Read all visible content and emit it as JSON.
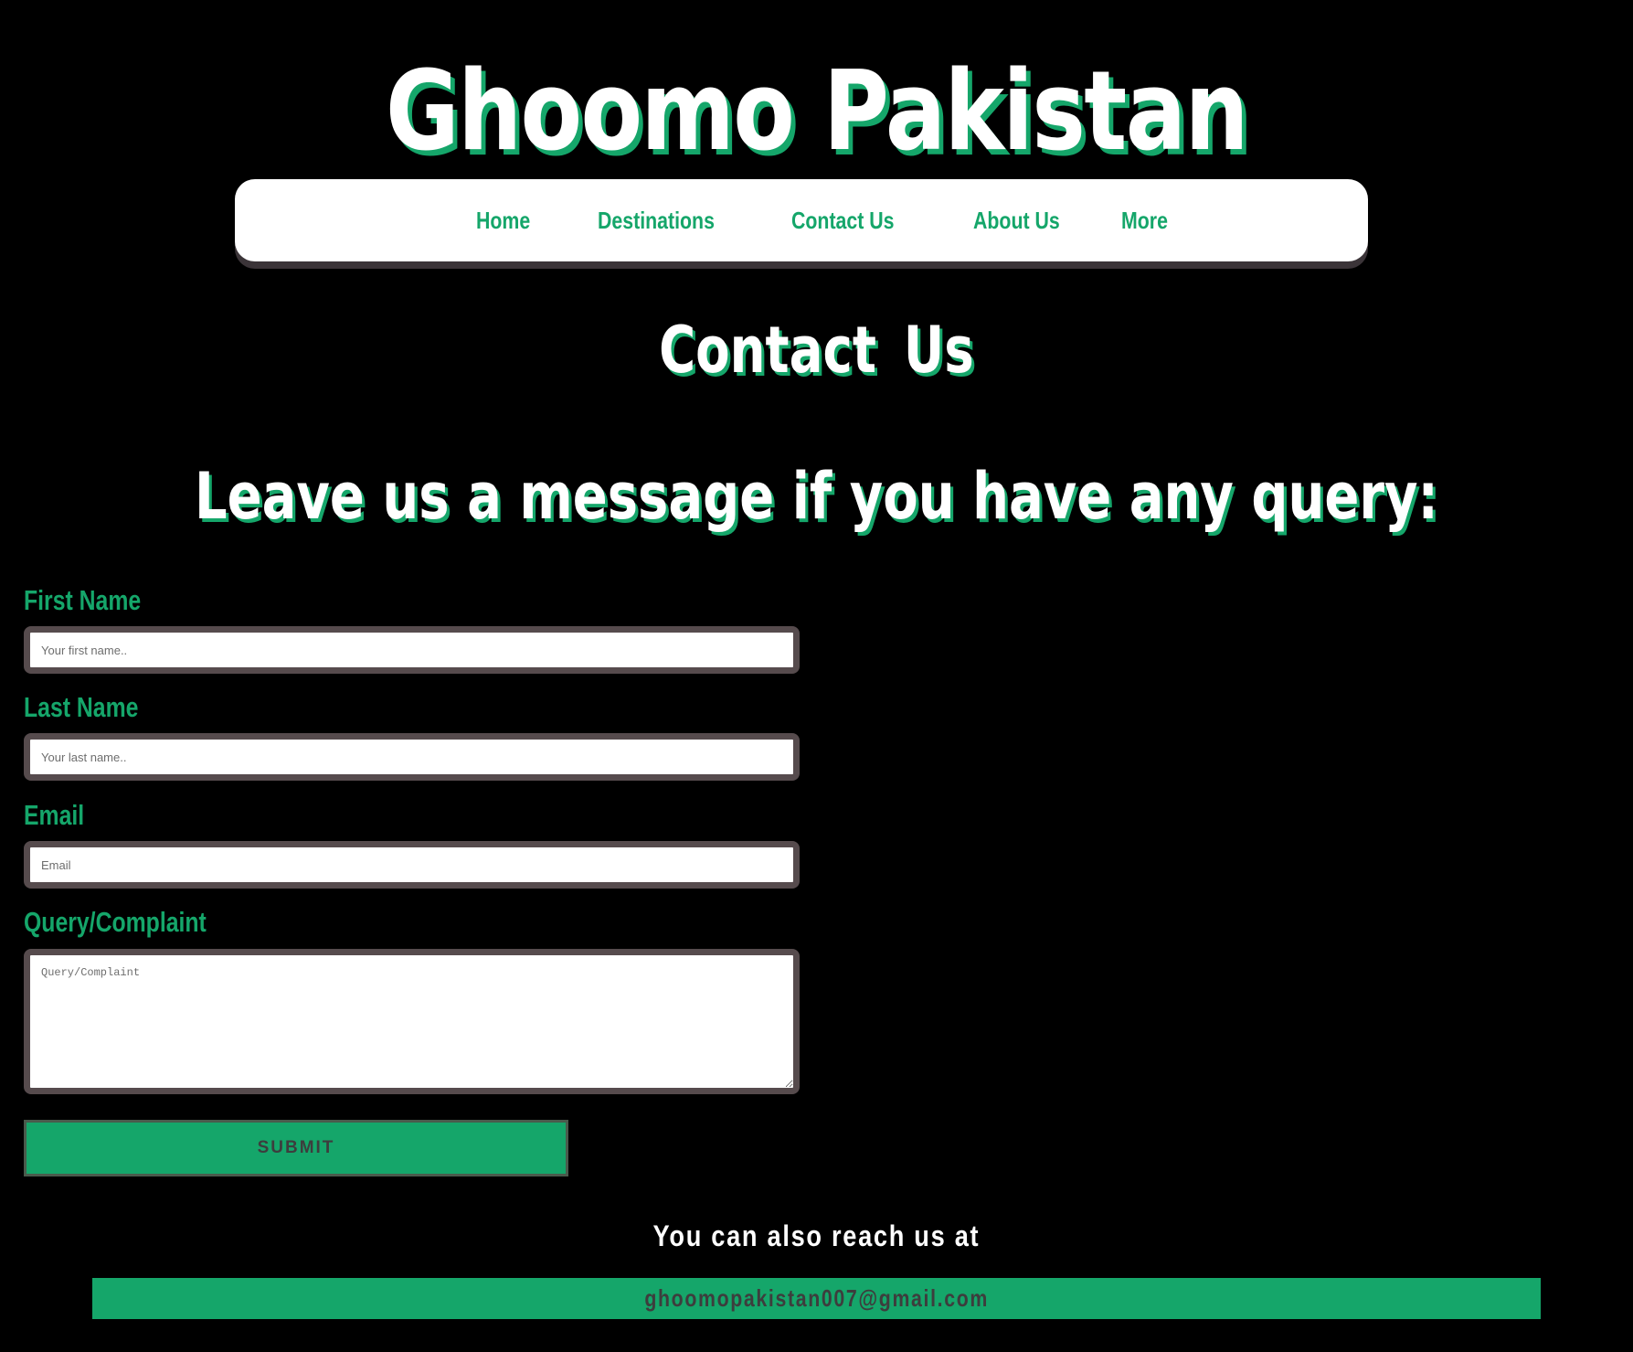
{
  "site": {
    "title": "Ghoomo Pakistan"
  },
  "nav": {
    "items": [
      {
        "label": "Home"
      },
      {
        "label": "Destinations"
      },
      {
        "label": "Contact Us"
      },
      {
        "label": "About Us"
      },
      {
        "label": "More"
      }
    ]
  },
  "page": {
    "heading": "Contact  Us",
    "subheading": "Leave us a message if you have any query:"
  },
  "form": {
    "first_name": {
      "label": "First Name",
      "placeholder": "Your first name.."
    },
    "last_name": {
      "label": "Last Name",
      "placeholder": "Your last name.."
    },
    "email": {
      "label": "Email",
      "placeholder": "Email"
    },
    "query": {
      "label": "Query/Complaint",
      "placeholder": "Query/Complaint"
    },
    "submit_label": "SUBMIT"
  },
  "footer": {
    "reach_text": "You can also reach us at",
    "email": "ghoomopakistan007@gmail.com"
  },
  "colors": {
    "background": "#000000",
    "accent": "#15a66a",
    "field_border": "#564b4d",
    "nav_background": "#ffffff"
  }
}
